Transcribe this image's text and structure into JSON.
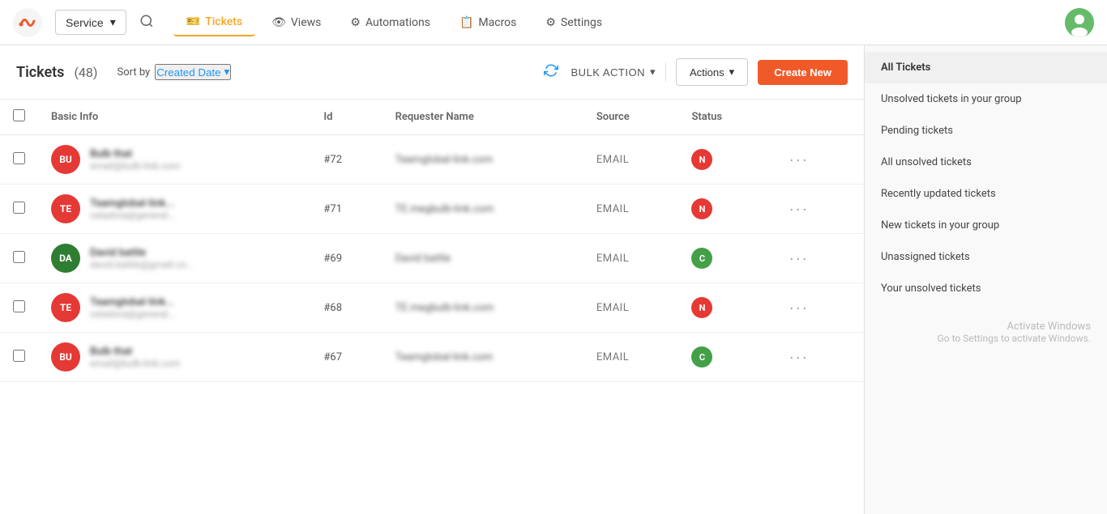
{
  "app": {
    "title": "Service"
  },
  "topnav": {
    "service_label": "Service",
    "search_placeholder": "Search",
    "nav_items": [
      {
        "id": "tickets",
        "label": "Tickets",
        "icon": "🎫",
        "active": true
      },
      {
        "id": "views",
        "label": "Views",
        "icon": "👁"
      },
      {
        "id": "automations",
        "label": "Automations",
        "icon": "⚙"
      },
      {
        "id": "macros",
        "label": "Macros",
        "icon": "📋"
      },
      {
        "id": "settings",
        "label": "Settings",
        "icon": "⚙"
      }
    ]
  },
  "toolbar": {
    "title": "Tickets",
    "count": "(48)",
    "sort_label": "Sort by",
    "sort_value": "Created Date",
    "bulk_action_label": "BULK ACTION",
    "actions_label": "Actions",
    "create_new_label": "Create New"
  },
  "table": {
    "columns": [
      "Basic Info",
      "Id",
      "Requester Name",
      "Source",
      "Status"
    ],
    "rows": [
      {
        "avatar_initials": "BU",
        "avatar_color": "#e53935",
        "name": "Bulb that",
        "email": "email@bulb-link.com",
        "id": "#72",
        "requester": "Teamglobal-link.com",
        "source": "EMAIL",
        "status": "N",
        "status_type": "n"
      },
      {
        "avatar_initials": "TE",
        "avatar_color": "#e53935",
        "name": "Teamglobal-link...",
        "email": "celadora@general...",
        "id": "#71",
        "requester": "TE.megbulb-link.com",
        "source": "EMAIL",
        "status": "N",
        "status_type": "n"
      },
      {
        "avatar_initials": "DA",
        "avatar_color": "#2e7d32",
        "name": "David battle",
        "email": "david.battle@gmail.co...",
        "id": "#69",
        "requester": "David battle",
        "source": "EMAIL",
        "status": "C",
        "status_type": "c"
      },
      {
        "avatar_initials": "TE",
        "avatar_color": "#e53935",
        "name": "Teamglobal-link...",
        "email": "celadora@general...",
        "id": "#68",
        "requester": "TE.megbulb-link.com",
        "source": "EMAIL",
        "status": "N",
        "status_type": "n"
      },
      {
        "avatar_initials": "BU",
        "avatar_color": "#e53935",
        "name": "Bulb that",
        "email": "email@bulb-link.com",
        "id": "#67",
        "requester": "Teamglobal-link.com",
        "source": "EMAIL",
        "status": "C",
        "status_type": "c"
      }
    ]
  },
  "sidebar": {
    "items": [
      {
        "id": "all-tickets",
        "label": "All Tickets",
        "active": true
      },
      {
        "id": "unsolved-group",
        "label": "Unsolved tickets in your group",
        "active": false
      },
      {
        "id": "pending",
        "label": "Pending tickets",
        "active": false
      },
      {
        "id": "all-unsolved",
        "label": "All unsolved tickets",
        "active": false
      },
      {
        "id": "recently-updated",
        "label": "Recently updated tickets",
        "active": false
      },
      {
        "id": "new-in-group",
        "label": "New tickets in your group",
        "active": false
      },
      {
        "id": "unassigned",
        "label": "Unassigned tickets",
        "active": false
      },
      {
        "id": "your-unsolved",
        "label": "Your unsolved tickets",
        "active": false
      }
    ]
  },
  "activate_windows": {
    "title": "Activate Windows",
    "subtitle": "Go to Settings to activate Windows."
  }
}
